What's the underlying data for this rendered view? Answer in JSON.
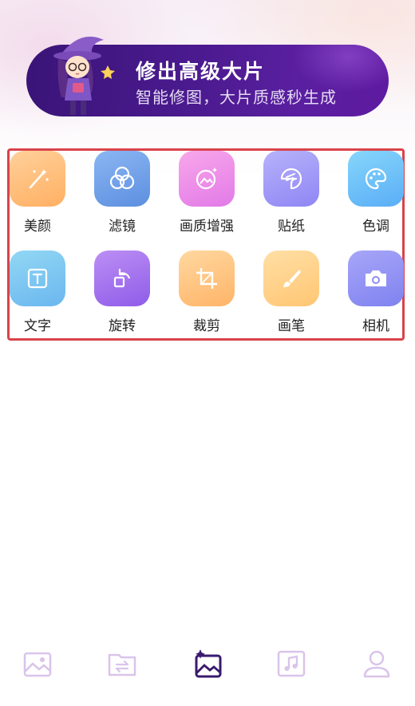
{
  "banner": {
    "title": "修出高级大片",
    "subtitle": "智能修图，大片质感秒生成"
  },
  "tools": [
    {
      "label": "美颜",
      "icon": "magic-wand-icon",
      "color": "#ffb063"
    },
    {
      "label": "滤镜",
      "icon": "filter-circles-icon",
      "color": "#5d8fe0"
    },
    {
      "label": "画质增强",
      "icon": "image-enhance-icon",
      "color": "#e27ae8"
    },
    {
      "label": "贴纸",
      "icon": "sticker-icon",
      "color": "#8f86f3"
    },
    {
      "label": "色调",
      "icon": "palette-icon",
      "color": "#5aaef6"
    },
    {
      "label": "文字",
      "icon": "text-icon",
      "color": "#6ab7ef"
    },
    {
      "label": "旋转",
      "icon": "rotate-icon",
      "color": "#8f5ce8"
    },
    {
      "label": "裁剪",
      "icon": "crop-icon",
      "color": "#ffb468"
    },
    {
      "label": "画笔",
      "icon": "brush-icon",
      "color": "#ffc673"
    },
    {
      "label": "相机",
      "icon": "camera-icon",
      "color": "#8082f0"
    }
  ],
  "nav": {
    "items": [
      {
        "icon": "gallery-icon",
        "active": false
      },
      {
        "icon": "folder-transfer-icon",
        "active": false
      },
      {
        "icon": "ai-edit-icon",
        "active": true
      },
      {
        "icon": "music-icon",
        "active": false
      },
      {
        "icon": "profile-icon",
        "active": false
      }
    ],
    "active_color": "#3a1a6e",
    "inactive_color": "#d9c4ea"
  }
}
